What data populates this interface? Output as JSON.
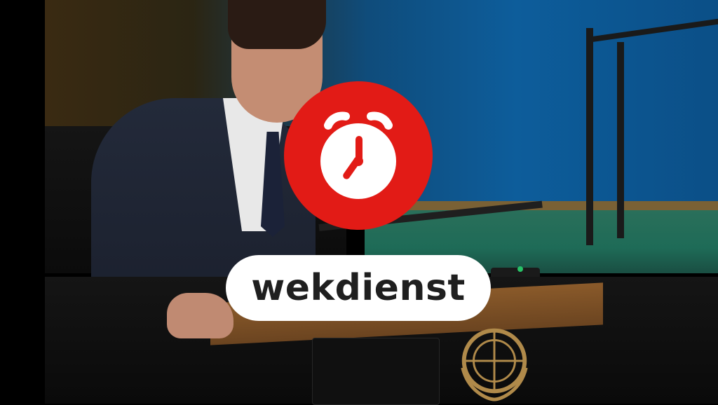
{
  "overlay": {
    "label": "wekdienst",
    "icon": "alarm-clock-icon",
    "accent_color": "#e21b16",
    "pill_color": "#ffffff",
    "text_color": "#1f1f1f"
  },
  "photo": {
    "emblem": "un-emblem",
    "led_color": "#27c267"
  }
}
